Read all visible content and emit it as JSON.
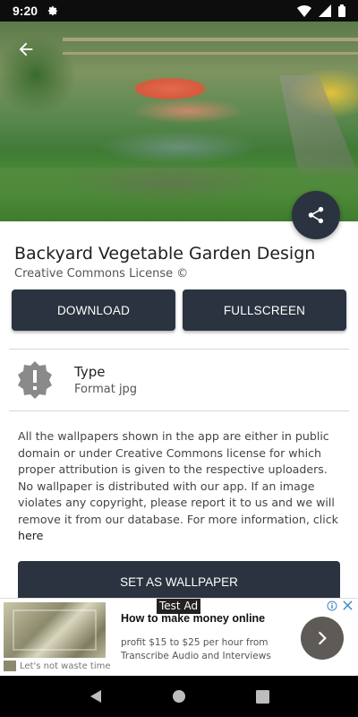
{
  "status": {
    "time": "9:20"
  },
  "detail": {
    "title": "Backyard Vegetable Garden Design",
    "license": "Creative Commons License ©",
    "download_label": "DOWNLOAD",
    "fullscreen_label": "FULLSCREEN",
    "type_label": "Type",
    "type_value": "Format jpg",
    "description": "All the wallpapers shown in the app are either in public domain or under Creative Commons license for which proper attribution is given to the respective uploaders. No wallpaper is distributed with our app. If an image violates any copyright, please report it to us and we will remove it from our database. For more information, click ",
    "here_link": "here",
    "set_wallpaper_label": "SET AS WALLPAPER"
  },
  "ad": {
    "label": "Test Ad",
    "headline": "How to make money online",
    "body": "profit $15 to $25 per hour from Transcribe Audio and Interviews",
    "tagline": "Let's not waste time"
  },
  "colors": {
    "button_bg": "#2b3340",
    "status_bg": "#0d0d0d"
  },
  "icons": [
    "settings-gear-icon",
    "wifi-icon",
    "signal-icon",
    "battery-icon",
    "back-arrow-icon",
    "share-icon",
    "alert-badge-icon",
    "adchoices-icon",
    "chevron-right-icon",
    "nav-back-icon",
    "nav-home-icon",
    "nav-recents-icon"
  ]
}
